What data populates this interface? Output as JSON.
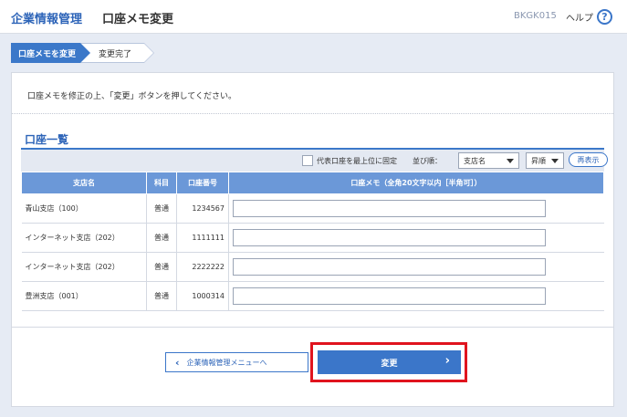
{
  "header": {
    "app_title": "企業情報管理",
    "page_title": "口座メモ変更",
    "screen_id": "BKGK015",
    "help_label": "ヘルプ",
    "help_icon": "help-circle-icon"
  },
  "steps": [
    {
      "label": "口座メモを変更",
      "state": "current"
    },
    {
      "label": "変更完了",
      "state": "pending"
    }
  ],
  "instruction": "口座メモを修正の上、「変更」ボタンを押してください。",
  "section_title": "口座一覧",
  "toolbar": {
    "pin_label": "代表口座を最上位に固定",
    "sort_label": "並び順：",
    "sort_field": "支店名",
    "sort_order": "昇順",
    "redisplay_label": "再表示"
  },
  "table": {
    "headers": [
      "支店名",
      "科目",
      "口座番号",
      "口座メモ（全角20文字以内［半角可］）"
    ],
    "rows": [
      {
        "branch": "青山支店（100）",
        "subject": "普通",
        "number": "1234567",
        "memo": ""
      },
      {
        "branch": "インターネット支店（202）",
        "subject": "普通",
        "number": "1111111",
        "memo": ""
      },
      {
        "branch": "インターネット支店（202）",
        "subject": "普通",
        "number": "2222222",
        "memo": ""
      },
      {
        "branch": "豊洲支店（001）",
        "subject": "普通",
        "number": "1000314",
        "memo": ""
      }
    ]
  },
  "buttons": {
    "back_label": "企業情報管理メニューへ",
    "change_label": "変更"
  },
  "colors": {
    "accent": "#3b76c9",
    "header_row": "#6b98d8",
    "highlight": "#e0141e",
    "background": "#e6ebf4"
  }
}
